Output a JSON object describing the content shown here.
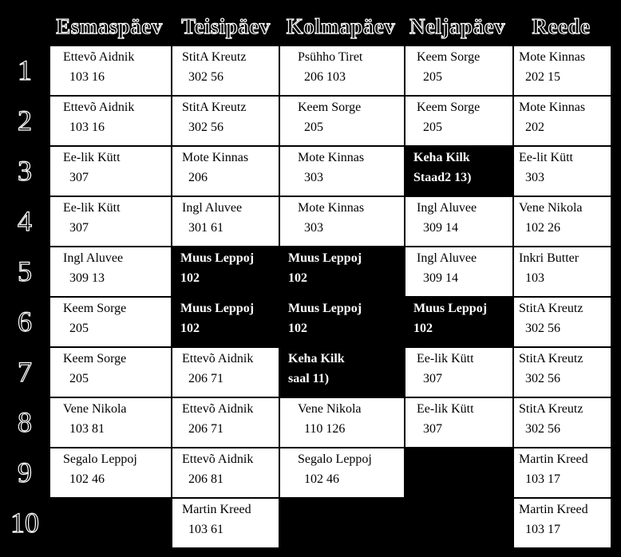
{
  "days": [
    "Esmaspäev",
    "Teisipäev",
    "Kolmapäev",
    "Neljapäev",
    "Reede"
  ],
  "rows": [
    "1",
    "2",
    "3",
    "4",
    "5",
    "6",
    "7",
    "8",
    "9",
    "10"
  ],
  "grid": [
    [
      {
        "t": "Ettevõ Aidnik",
        "s": "103     16"
      },
      {
        "t": "StitA Kreutz",
        "s": "302     56"
      },
      {
        "t": "Psühho Tiret",
        "s": "206       103"
      },
      {
        "t": "Keem Sorge",
        "s": "205"
      },
      {
        "t": "Mote Kinnas",
        "s": "202     15"
      }
    ],
    [
      {
        "t": "Ettevõ Aidnik",
        "s": "103     16"
      },
      {
        "t": "StitA Kreutz",
        "s": "302     56"
      },
      {
        "t": "Keem Sorge",
        "s": "205"
      },
      {
        "t": "Keem Sorge",
        "s": "205"
      },
      {
        "t": "Mote Kinnas",
        "s": "202"
      }
    ],
    [
      {
        "t": "Ee-lik Kütt",
        "s": "307"
      },
      {
        "t": "Mote Kinnas",
        "s": "206"
      },
      {
        "t": "Mote Kinnas",
        "s": "303"
      },
      {
        "t": "Keha   Kilk",
        "s": "Staad2 13)",
        "dark": true
      },
      {
        "t": "Ee-lit Kütt",
        "s": "303"
      }
    ],
    [
      {
        "t": "Ee-lik Kütt",
        "s": "307"
      },
      {
        "t": "Ingl Aluvee",
        "s": "301  61"
      },
      {
        "t": "Mote Kinnas",
        "s": "303"
      },
      {
        "t": "Ingl Aluvee",
        "s": "309  14"
      },
      {
        "t": "Vene Nikola",
        "s": "102   26"
      }
    ],
    [
      {
        "t": "Ingl Aluvee",
        "s": "309  13"
      },
      {
        "t": "Muus Leppoj",
        "s": "102",
        "dark": true
      },
      {
        "t": "Muus Leppoj",
        "s": "102",
        "dark": true
      },
      {
        "t": "Ingl Aluvee",
        "s": "309  14"
      },
      {
        "t": "Inkri Butter",
        "s": "103"
      }
    ],
    [
      {
        "t": "Keem Sorge",
        "s": "205"
      },
      {
        "t": "Muus Leppoj",
        "s": "102",
        "dark": true
      },
      {
        "t": "Muus Leppoj",
        "s": "102",
        "dark": true
      },
      {
        "t": "Muus Leppoj",
        "s": "102",
        "dark": true
      },
      {
        "t": "StitA Kreutz",
        "s": "302     56"
      }
    ],
    [
      {
        "t": "Keem Sorge",
        "s": "205"
      },
      {
        "t": "Ettevõ Aidnik",
        "s": "206     71"
      },
      {
        "t": "Keha Kilk",
        "s": "saal    11)",
        "dark": true
      },
      {
        "t": "Ee-lik Kütt",
        "s": "307"
      },
      {
        "t": "StitA Kreutz",
        "s": "302     56"
      }
    ],
    [
      {
        "t": "Vene Nikola",
        "s": "103    81"
      },
      {
        "t": "Ettevõ Aidnik",
        "s": "206     71"
      },
      {
        "t": "Vene Nikola",
        "s": "110   126"
      },
      {
        "t": "Ee-lik Kütt",
        "s": "307"
      },
      {
        "t": "StitA Kreutz",
        "s": "302     56"
      }
    ],
    [
      {
        "t": "Segalo Leppoj",
        "s": "102      46"
      },
      {
        "t": "Ettevõ Aidnik",
        "s": "206     81"
      },
      {
        "t": "Segalo Leppoj",
        "s": "102      46"
      },
      {
        "empty": true
      },
      {
        "t": "Martin Kreed",
        "s": "103     17"
      }
    ],
    [
      {
        "empty": true
      },
      {
        "t": "Martin Kreed",
        "s": "103     61"
      },
      {
        "empty": true
      },
      {
        "empty": true
      },
      {
        "t": "Martin Kreed",
        "s": "103     17"
      }
    ]
  ]
}
